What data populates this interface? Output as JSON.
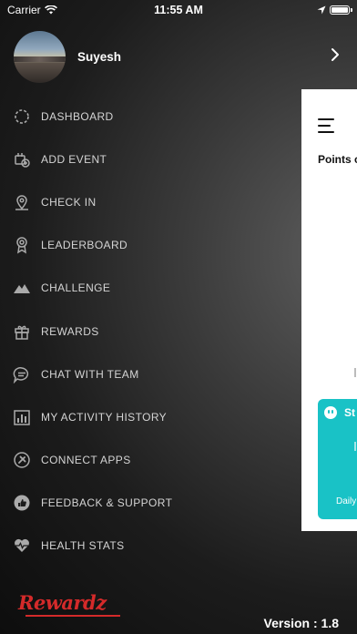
{
  "status_bar": {
    "carrier": "Carrier",
    "time": "11:55 AM"
  },
  "profile": {
    "name": "Suyesh"
  },
  "menu": {
    "items": [
      {
        "label": "DASHBOARD",
        "icon": "dashboard-icon"
      },
      {
        "label": "ADD EVENT",
        "icon": "add-event-icon"
      },
      {
        "label": "CHECK IN",
        "icon": "map-pin-icon"
      },
      {
        "label": "LEADERBOARD",
        "icon": "award-icon"
      },
      {
        "label": "CHALLENGE",
        "icon": "mountain-icon"
      },
      {
        "label": "REWARDS",
        "icon": "gift-icon"
      },
      {
        "label": "CHAT WITH TEAM",
        "icon": "chat-icon"
      },
      {
        "label": "MY ACTIVITY HISTORY",
        "icon": "bar-chart-icon"
      },
      {
        "label": "CONNECT APPS",
        "icon": "link-icon"
      },
      {
        "label": "FEEDBACK & SUPPORT",
        "icon": "thumbs-up-icon"
      },
      {
        "label": "HEALTH STATS",
        "icon": "heart-pulse-icon"
      }
    ]
  },
  "footer": {
    "logo_text": "Rewardz",
    "version": "Version : 1.8"
  },
  "background_panel": {
    "label": "Points c",
    "card_title": "St",
    "card_footer": "Daily"
  },
  "colors": {
    "brand_red": "#d42a2a",
    "teal": "#19c2c6"
  }
}
